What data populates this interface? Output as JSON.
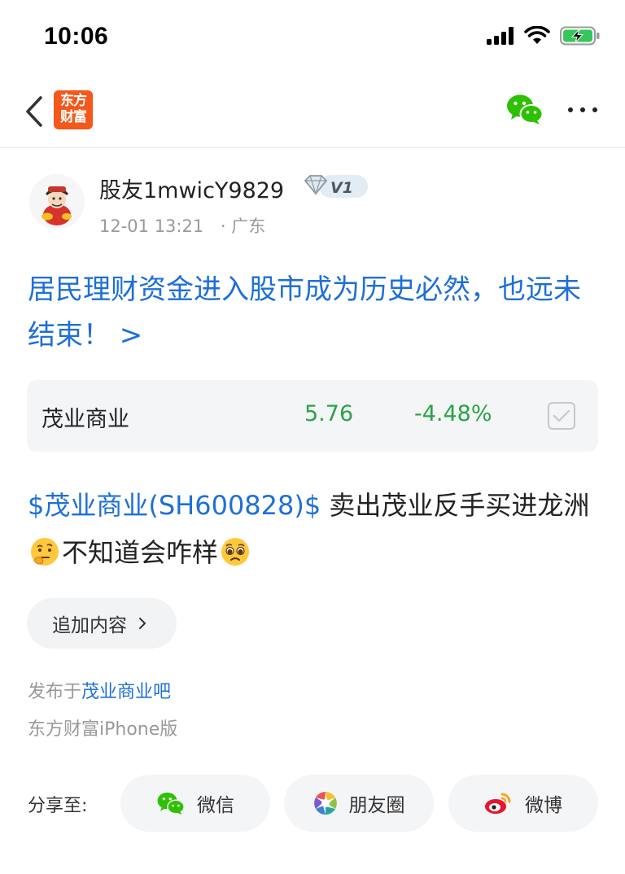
{
  "status_bar": {
    "time": "10:06"
  },
  "nav": {
    "logo_line1": "东方",
    "logo_line2": "财富",
    "brand_color": "#f4581a"
  },
  "author": {
    "name": "股友1mwicY9829",
    "level": "V1",
    "date": "12-01 13:21",
    "location": "· 广东"
  },
  "post": {
    "title": "居民理财资金进入股市成为历史必然，也远未结束！ >",
    "body_stock_link": "$茂业商业(SH600828)$",
    "body_text_1": " 卖出茂业反手买进龙洲",
    "body_text_2": "不知道会咋样",
    "emoji_1": "thinking-face-icon",
    "emoji_2": "pleading-face-icon"
  },
  "stock_card": {
    "name": "茂业商业",
    "price": "5.76",
    "change": "-4.48%",
    "down_color": "#2ba245"
  },
  "add_content": {
    "label": "追加内容"
  },
  "publish": {
    "prefix": "发布于",
    "forum": "茂业商业吧",
    "client": "东方财富iPhone版"
  },
  "share": {
    "label": "分享至:",
    "buttons": [
      {
        "label": "微信",
        "icon": "wechat-icon"
      },
      {
        "label": "朋友圈",
        "icon": "moments-icon"
      },
      {
        "label": "微博",
        "icon": "weibo-icon"
      }
    ]
  },
  "colors": {
    "link_blue": "#1e6fd9",
    "wechat_green": "#2dc100"
  }
}
